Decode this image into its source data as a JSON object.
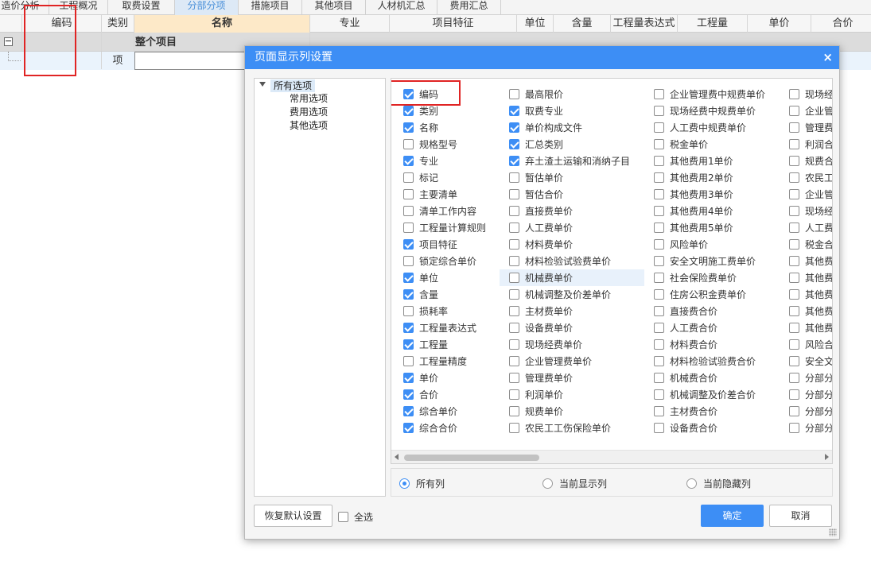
{
  "tabs": [
    {
      "label": "造价分析",
      "active": false
    },
    {
      "label": "工程概况",
      "active": false
    },
    {
      "label": "取费设置",
      "active": false
    },
    {
      "label": "分部分项",
      "active": true
    },
    {
      "label": "措施项目",
      "active": false
    },
    {
      "label": "其他项目",
      "active": false
    },
    {
      "label": "人材机汇总",
      "active": false
    },
    {
      "label": "费用汇总",
      "active": false
    }
  ],
  "grid": {
    "headers": [
      "",
      "编码",
      "类别",
      "名称",
      "专业",
      "项目特征",
      "单位",
      "含量",
      "工程量表达式",
      "工程量",
      "单价",
      "合价"
    ],
    "row1": {
      "toggle": "−",
      "name": "整个项目"
    },
    "row2": {
      "type": "项"
    }
  },
  "dialog": {
    "title": "页面显示列设置",
    "close_icon": "×",
    "tree": {
      "root": "所有选项",
      "children": [
        "常用选项",
        "费用选项",
        "其他选项"
      ]
    },
    "columns": [
      [
        {
          "label": "编码",
          "checked": true
        },
        {
          "label": "类别",
          "checked": true
        },
        {
          "label": "名称",
          "checked": true
        },
        {
          "label": "规格型号",
          "checked": false
        },
        {
          "label": "专业",
          "checked": true
        },
        {
          "label": "标记",
          "checked": false
        },
        {
          "label": "主要清单",
          "checked": false
        },
        {
          "label": "清单工作内容",
          "checked": false
        },
        {
          "label": "工程量计算规则",
          "checked": false
        },
        {
          "label": "项目特征",
          "checked": true
        },
        {
          "label": "锁定综合单价",
          "checked": false
        },
        {
          "label": "单位",
          "checked": true
        },
        {
          "label": "含量",
          "checked": true
        },
        {
          "label": "损耗率",
          "checked": false
        },
        {
          "label": "工程量表达式",
          "checked": true
        },
        {
          "label": "工程量",
          "checked": true
        },
        {
          "label": "工程量精度",
          "checked": false
        },
        {
          "label": "单价",
          "checked": true
        },
        {
          "label": "合价",
          "checked": true
        },
        {
          "label": "综合单价",
          "checked": true
        },
        {
          "label": "综合合价",
          "checked": true
        }
      ],
      [
        {
          "label": "最高限价",
          "checked": false
        },
        {
          "label": "取费专业",
          "checked": true
        },
        {
          "label": "单价构成文件",
          "checked": true
        },
        {
          "label": "汇总类别",
          "checked": true
        },
        {
          "label": "弃土渣土运输和消纳子目",
          "checked": true
        },
        {
          "label": "暂估单价",
          "checked": false
        },
        {
          "label": "暂估合价",
          "checked": false
        },
        {
          "label": "直接费单价",
          "checked": false
        },
        {
          "label": "人工费单价",
          "checked": false
        },
        {
          "label": "材料费单价",
          "checked": false
        },
        {
          "label": "材料检验试验费单价",
          "checked": false
        },
        {
          "label": "机械费单价",
          "checked": false
        },
        {
          "label": "机械调整及价差单价",
          "checked": false
        },
        {
          "label": "主材费单价",
          "checked": false
        },
        {
          "label": "设备费单价",
          "checked": false
        },
        {
          "label": "现场经费单价",
          "checked": false
        },
        {
          "label": "企业管理费单价",
          "checked": false
        },
        {
          "label": "管理费单价",
          "checked": false
        },
        {
          "label": "利润单价",
          "checked": false
        },
        {
          "label": "规费单价",
          "checked": false
        },
        {
          "label": "农民工工伤保险单价",
          "checked": false
        }
      ],
      [
        {
          "label": "企业管理费中规费单价",
          "checked": false
        },
        {
          "label": "现场经费中规费单价",
          "checked": false
        },
        {
          "label": "人工费中规费单价",
          "checked": false
        },
        {
          "label": "税金单价",
          "checked": false
        },
        {
          "label": "其他费用1单价",
          "checked": false
        },
        {
          "label": "其他费用2单价",
          "checked": false
        },
        {
          "label": "其他费用3单价",
          "checked": false
        },
        {
          "label": "其他费用4单价",
          "checked": false
        },
        {
          "label": "其他费用5单价",
          "checked": false
        },
        {
          "label": "风险单价",
          "checked": false
        },
        {
          "label": "安全文明施工费单价",
          "checked": false
        },
        {
          "label": "社会保险费单价",
          "checked": false
        },
        {
          "label": "住房公积金费单价",
          "checked": false
        },
        {
          "label": "直接费合价",
          "checked": false
        },
        {
          "label": "人工费合价",
          "checked": false
        },
        {
          "label": "材料费合价",
          "checked": false
        },
        {
          "label": "材料检验试验费合价",
          "checked": false
        },
        {
          "label": "机械费合价",
          "checked": false
        },
        {
          "label": "机械调整及价差合价",
          "checked": false
        },
        {
          "label": "主材费合价",
          "checked": false
        },
        {
          "label": "设备费合价",
          "checked": false
        }
      ],
      [
        {
          "label": "现场经",
          "checked": false
        },
        {
          "label": "企业管",
          "checked": false
        },
        {
          "label": "管理费",
          "checked": false
        },
        {
          "label": "利润合",
          "checked": false
        },
        {
          "label": "规费合",
          "checked": false
        },
        {
          "label": "农民工",
          "checked": false
        },
        {
          "label": "企业管",
          "checked": false
        },
        {
          "label": "现场经",
          "checked": false
        },
        {
          "label": "人工费",
          "checked": false
        },
        {
          "label": "税金合",
          "checked": false
        },
        {
          "label": "其他费",
          "checked": false
        },
        {
          "label": "其他费",
          "checked": false
        },
        {
          "label": "其他费",
          "checked": false
        },
        {
          "label": "其他费",
          "checked": false
        },
        {
          "label": "其他费",
          "checked": false
        },
        {
          "label": "风险合",
          "checked": false
        },
        {
          "label": "安全文",
          "checked": false
        },
        {
          "label": "分部分",
          "checked": false
        },
        {
          "label": "分部分",
          "checked": false
        },
        {
          "label": "分部分",
          "checked": false
        },
        {
          "label": "分部分",
          "checked": false
        }
      ]
    ],
    "radios": [
      {
        "label": "所有列",
        "selected": true
      },
      {
        "label": "当前显示列",
        "selected": false
      },
      {
        "label": "当前隐藏列",
        "selected": false
      }
    ],
    "restore_label": "恢复默认设置",
    "select_all_label": "全选",
    "ok_label": "确定",
    "cancel_label": "取消"
  },
  "colors": {
    "accent": "#3d8ef5",
    "highlight_red": "#e02424",
    "active_tab_text": "#4a90d9"
  }
}
